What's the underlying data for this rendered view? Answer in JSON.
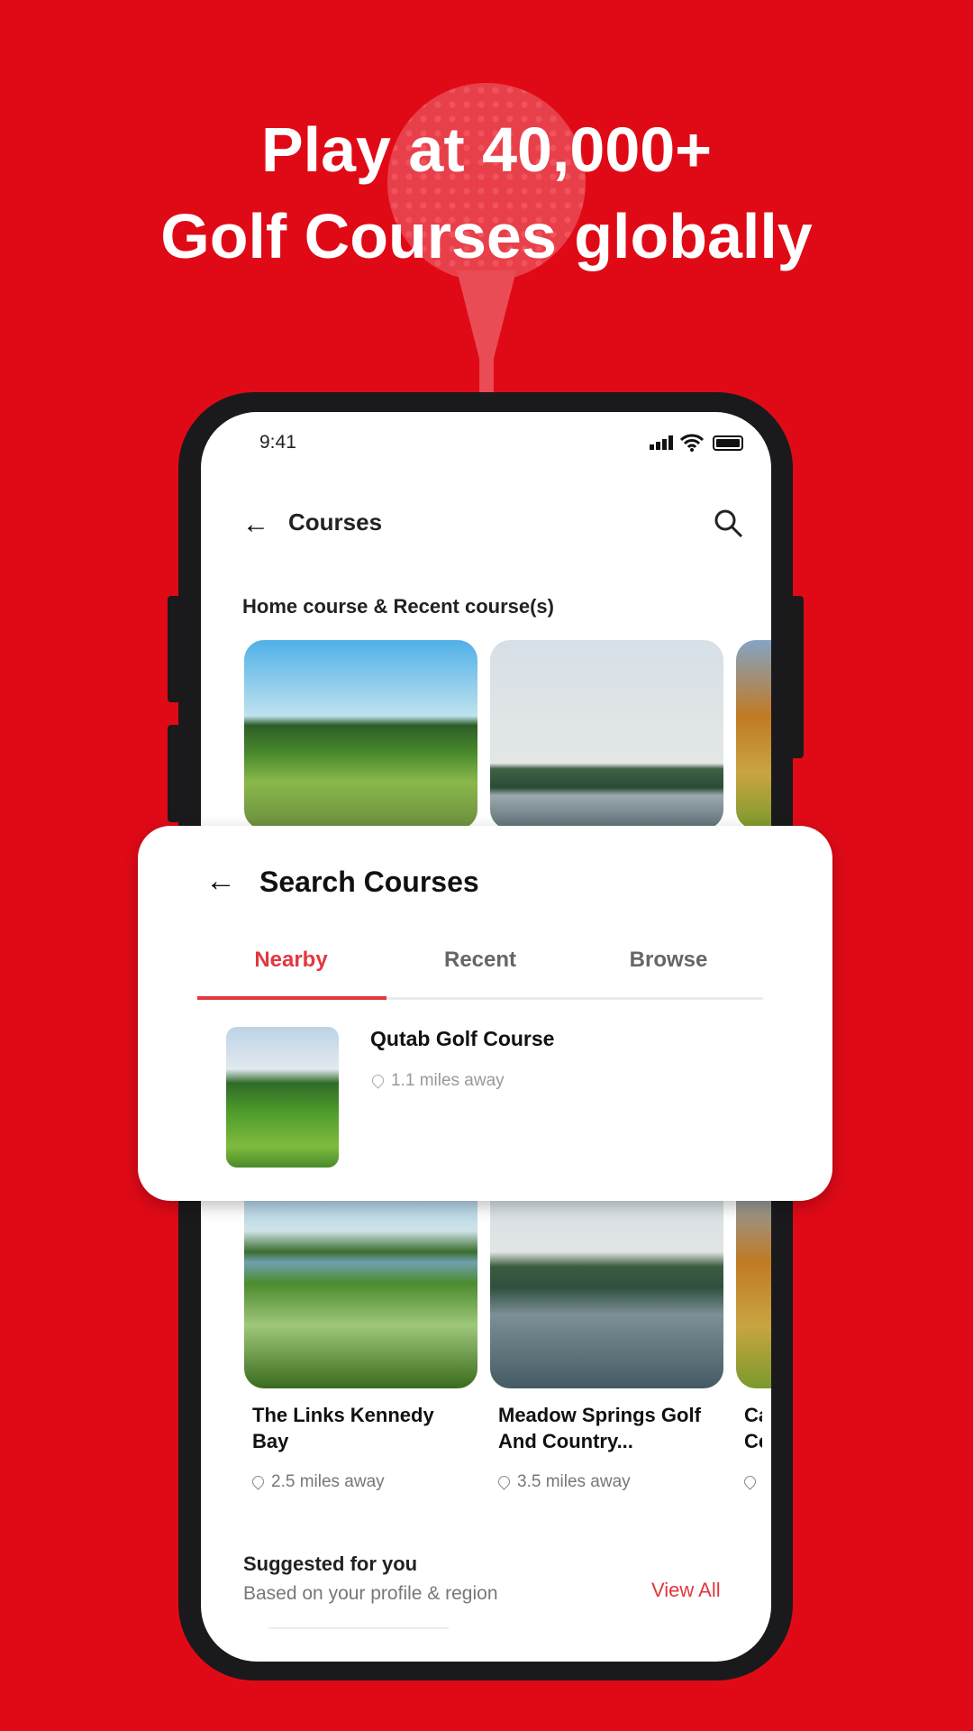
{
  "promo": {
    "headline_line1": "Play at 40,000+",
    "headline_line2": "Golf Courses globally"
  },
  "colors": {
    "background": "#e00a17",
    "accent": "#e2373f"
  },
  "status_bar": {
    "time": "9:41",
    "icons": [
      "signal-icon",
      "wifi-icon",
      "battery-icon"
    ]
  },
  "header": {
    "title": "Courses",
    "back_icon": "arrow-left-icon",
    "search_icon": "search-icon"
  },
  "home_section": {
    "title": "Home course & Recent course(s)"
  },
  "search_card": {
    "title": "Search Courses",
    "tabs": [
      {
        "label": "Nearby",
        "active": true
      },
      {
        "label": "Recent",
        "active": false
      },
      {
        "label": "Browse",
        "active": false
      }
    ],
    "results": [
      {
        "name": "Qutab Golf Course",
        "distance": "1.1 miles away"
      }
    ]
  },
  "nearby_courses": [
    {
      "name": "The Links Kennedy Bay",
      "distance": "2.5 miles away"
    },
    {
      "name": "Meadow Springs Golf And Country...",
      "distance": "3.5 miles away"
    },
    {
      "name": "Ca Ce",
      "distance": ""
    }
  ],
  "suggested": {
    "title": "Suggested for you",
    "subtitle": "Based on your profile & region",
    "view_all": "View All"
  }
}
